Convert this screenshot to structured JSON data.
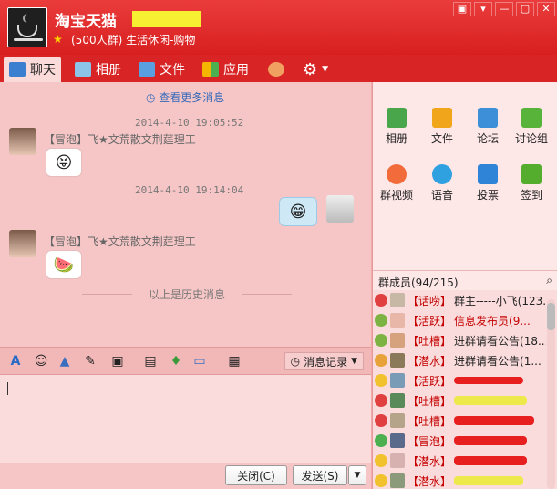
{
  "header": {
    "title": "淘宝天猫",
    "subtitle": "(500人群) 生活休闲-购物"
  },
  "window_controls": [
    "▣",
    "▾",
    "—",
    "▢",
    "✕"
  ],
  "tabs": [
    {
      "label": "聊天",
      "icon": "chat-icon"
    },
    {
      "label": "相册",
      "icon": "album-icon"
    },
    {
      "label": "文件",
      "icon": "folder-icon"
    },
    {
      "label": "应用",
      "icon": "apps-icon"
    }
  ],
  "chat": {
    "more": "查看更多消息",
    "messages": [
      {
        "time": "2014-4-10 19:05:52",
        "sender": "【冒泡】飞★文荒散文荆莛理工",
        "emoji": "😝"
      },
      {
        "time": "2014-4-10 19:14:04",
        "sender": "",
        "emoji": "😁"
      },
      {
        "time": "",
        "sender": "【冒泡】飞★文荒散文荆莛理工",
        "emoji": "🍉"
      }
    ],
    "history_divider": "以上是历史消息"
  },
  "toolbar": {
    "history_label": "消息记录"
  },
  "footer": {
    "close": "关闭(C)",
    "send": "发送(S)"
  },
  "apps": [
    {
      "label": "相册",
      "color": "#4aa64a"
    },
    {
      "label": "文件",
      "color": "#f0a51a"
    },
    {
      "label": "论坛",
      "color": "#3d8fd8"
    },
    {
      "label": "讨论组",
      "color": "#58b33a"
    },
    {
      "label": "群视频",
      "color": "#f26b3a"
    },
    {
      "label": "语音",
      "color": "#2fa0e0"
    },
    {
      "label": "投票",
      "color": "#2f84d8"
    },
    {
      "label": "签到",
      "color": "#55ad2e"
    }
  ],
  "members": {
    "header": "群成员(94/215)",
    "list": [
      {
        "tag": "【话唠】",
        "name": "群主-----小飞(123..."
      },
      {
        "tag": "【活跃】",
        "name": "信息发布员(9..."
      },
      {
        "tag": "【吐槽】",
        "name": "进群请看公告(18..."
      },
      {
        "tag": "【潜水】",
        "name": "进群请看公告(1..."
      },
      {
        "tag": "【活跃】",
        "name": ""
      },
      {
        "tag": "【吐槽】",
        "name": ""
      },
      {
        "tag": "【吐槽】",
        "name": ""
      },
      {
        "tag": "【冒泡】",
        "name": ""
      },
      {
        "tag": "【潜水】",
        "name": ""
      },
      {
        "tag": "【潜水】",
        "name": ""
      },
      {
        "tag": "【潜水】",
        "name": ""
      }
    ]
  }
}
